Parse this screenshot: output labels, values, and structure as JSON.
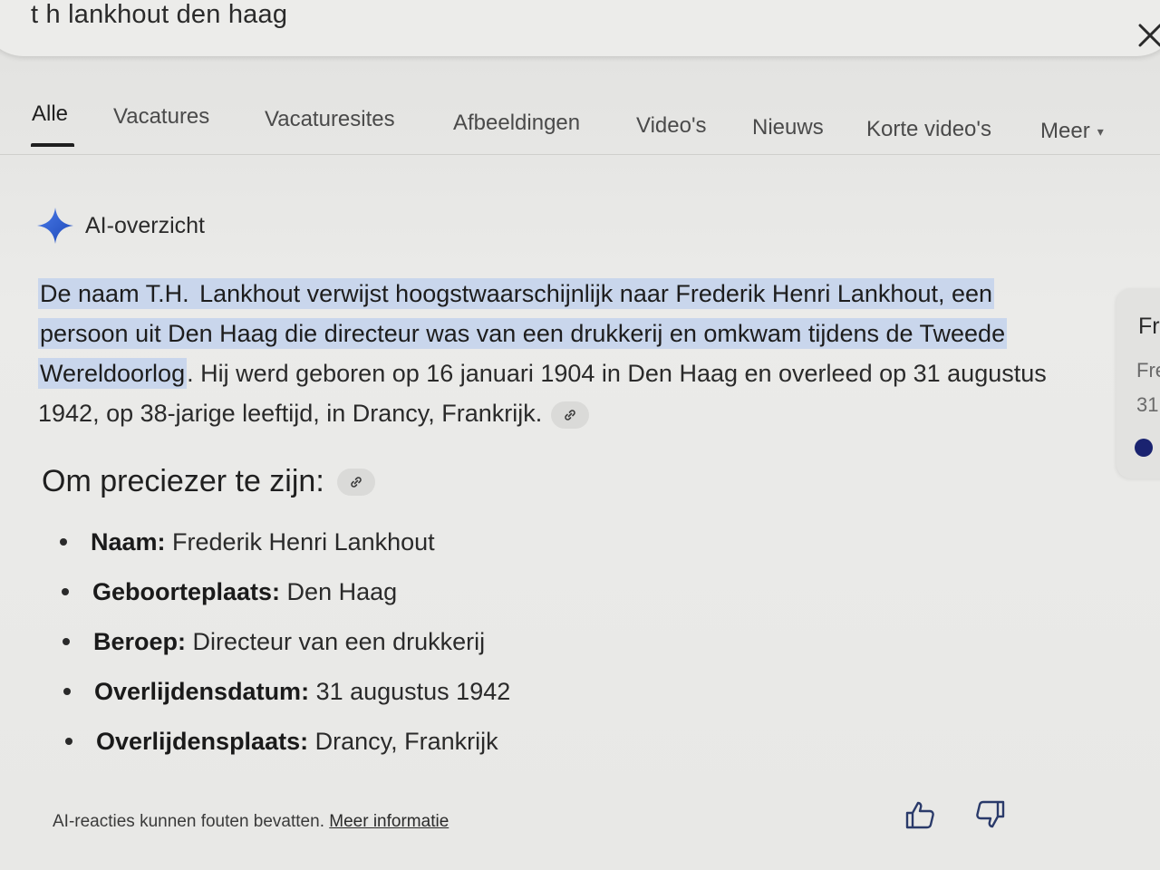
{
  "search": {
    "query": "t h lankhout den haag"
  },
  "tabs": [
    {
      "label": "Alle",
      "active": true
    },
    {
      "label": "Vacatures"
    },
    {
      "label": "Vacaturesites"
    },
    {
      "label": "Afbeeldingen"
    },
    {
      "label": "Video's"
    },
    {
      "label": "Nieuws"
    },
    {
      "label": "Korte video's"
    },
    {
      "label": "Meer"
    }
  ],
  "ai_overview": {
    "title": "AI-overzicht",
    "summary_highlight_1": "De naam T.H. ",
    "summary_highlight_2": "Lankhout verwijst hoogstwaarschijnlijk naar Frederik Henri Lankhout, een persoon uit Den Haag die directeur was van een drukkerij en omkwam tijdens de Tweede Wereldoorlog",
    "summary_rest": ". Hij werd geboren op 16 januari 1904 in Den Haag en overleed op 31 augustus 1942, op 38-jarige leeftijd, in Drancy, Frankrijk.",
    "subheading": "Om preciezer te zijn:",
    "facts": [
      {
        "key": "Naam:",
        "value": " Frederik Henri Lankhout"
      },
      {
        "key": "Geboorteplaats:",
        "value": " Den Haag"
      },
      {
        "key": "Beroep:",
        "value": " Directeur van een drukkerij"
      },
      {
        "key": "Overlijdensdatum:",
        "value": " 31 augustus 1942"
      },
      {
        "key": "Overlijdensplaats:",
        "value": " Drancy, Frankrijk"
      }
    ],
    "disclaimer": "AI-reacties kunnen fouten bevatten.",
    "disclaimer_link": "Meer informatie"
  },
  "side_card": {
    "title": "Fr",
    "line1": "Fre",
    "line2": "31"
  },
  "colors": {
    "highlight": "#c9d6ec",
    "sparkle": "#2f5fd0",
    "side_dot": "#1a2370"
  },
  "icons": [
    "close-icon",
    "sparkle-icon",
    "link-icon",
    "thumbs-up-icon",
    "thumbs-down-icon",
    "chevron-down-icon"
  ]
}
